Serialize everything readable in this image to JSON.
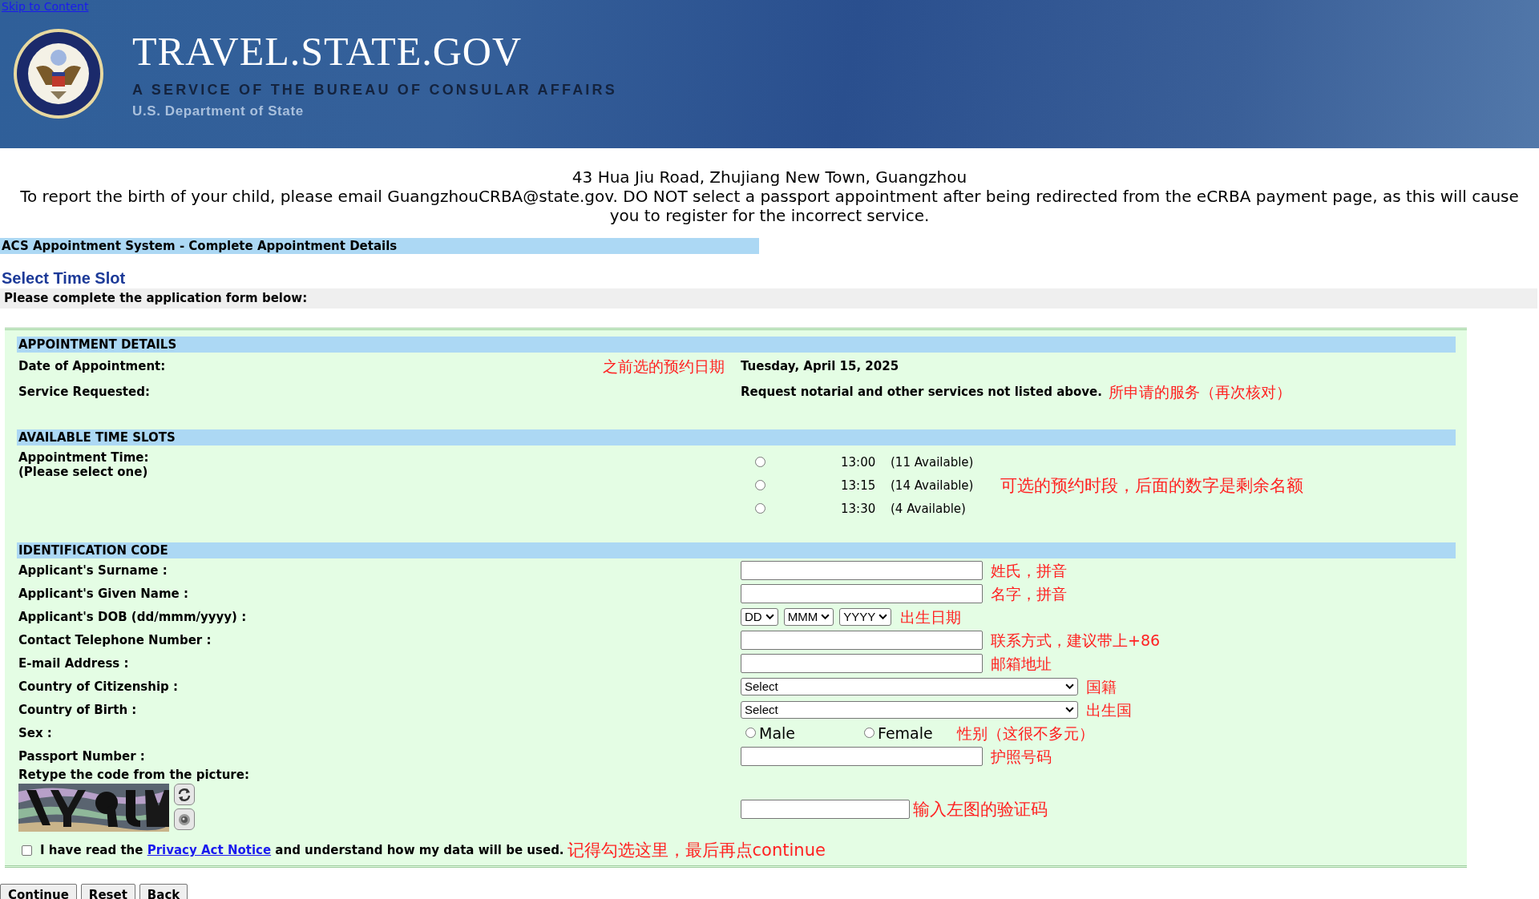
{
  "header": {
    "skip_link": "Skip to Content",
    "title": "TRAVEL.STATE.GOV",
    "tagline": "A SERVICE OF THE BUREAU OF CONSULAR AFFAIRS",
    "department": "U.S. Department of State"
  },
  "notice": {
    "address": "43 Hua Jiu Road, Zhujiang New Town, Guangzhou",
    "message": "To report the birth of your child, please email GuangzhouCRBA@state.gov. DO NOT select a passport appointment after being redirected from the eCRBA payment page, as this will cause you to register for the incorrect service."
  },
  "system_bar": "ACS Appointment System - Complete Appointment Details",
  "page_heading": "Select Time Slot",
  "instructions": "Please complete the application form below:",
  "appointment_details": {
    "heading": "APPOINTMENT DETAILS",
    "rows": [
      {
        "label": "Date of Appointment:",
        "value": "Tuesday, April 15, 2025",
        "note": "之前选的预约日期",
        "kind": "note_before_value"
      },
      {
        "label": "Service Requested:",
        "value": "Request notarial and other services not listed above.",
        "note": "所申请的服务（再次核对）",
        "kind": "note_after_value"
      }
    ]
  },
  "time_slots": {
    "heading": "AVAILABLE TIME SLOTS",
    "label": "Appointment Time:",
    "hint": "(Please select one)",
    "note": "可选的预约时段，后面的数字是剩余名额",
    "slots": [
      {
        "time": "13:00",
        "availability": "(11 Available)",
        "selected": false
      },
      {
        "time": "13:15",
        "availability": "(14 Available)",
        "selected": false
      },
      {
        "time": "13:30",
        "availability": "(4 Available)",
        "selected": false
      }
    ]
  },
  "identification": {
    "heading": "IDENTIFICATION CODE",
    "fields": [
      {
        "kind": "text",
        "label": "Applicant's Surname :",
        "note": "姓氏，拼音"
      },
      {
        "kind": "text",
        "label": "Applicant's Given Name :",
        "note": "名字，拼音"
      },
      {
        "kind": "date",
        "label": "Applicant's DOB  (dd/mmm/yyyy) :",
        "selects": [
          "DD",
          "MMM",
          "YYYY"
        ],
        "note": "出生日期"
      },
      {
        "kind": "text",
        "label": "Contact Telephone Number :",
        "note": "联系方式，建议带上+86"
      },
      {
        "kind": "text",
        "label": "E-mail Address :",
        "note": "邮箱地址"
      },
      {
        "kind": "select",
        "label": "Country of Citizenship :",
        "value": "Select",
        "note": "国籍"
      },
      {
        "kind": "select",
        "label": "Country of Birth :",
        "value": "Select",
        "note": "出生国"
      },
      {
        "kind": "radio",
        "label": "Sex :",
        "options": [
          {
            "label": "Male",
            "selected": false
          },
          {
            "label": "Female",
            "selected": false
          }
        ],
        "note": "性别（这很不多元）"
      },
      {
        "kind": "text",
        "label": "Passport Number :",
        "note": "护照号码"
      }
    ]
  },
  "captcha": {
    "label": "Retype the code from the picture:",
    "note": "输入左图的验证码"
  },
  "consent": {
    "checked": false,
    "text_before": "I have read the",
    "link": "Privacy Act Notice",
    "text_after": "and understand how my data will be used.",
    "note": "记得勾选这里，最后再点continue"
  },
  "buttons": [
    "Continue",
    "Reset",
    "Back"
  ]
}
